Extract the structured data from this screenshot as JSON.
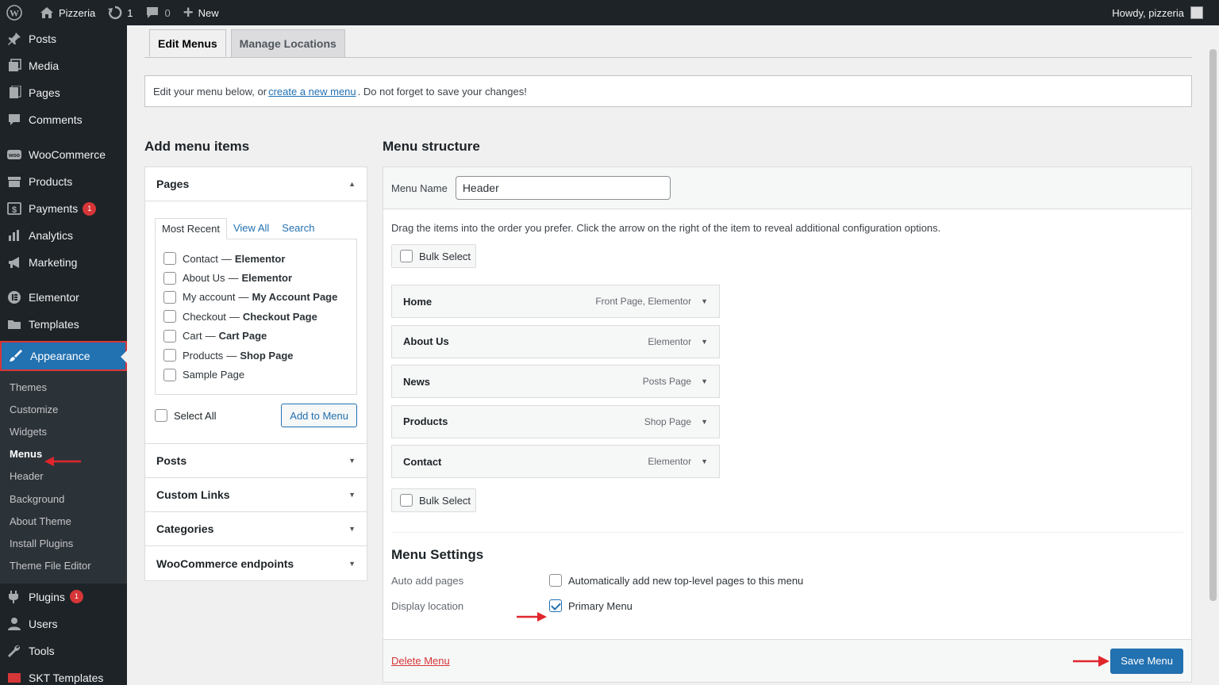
{
  "adminbar": {
    "site_name": "Pizzeria",
    "updates_count": "1",
    "comments_count": "0",
    "new_label": "New",
    "greeting": "Howdy, pizzeria"
  },
  "sidebar": {
    "items_top": [
      {
        "label": "Posts",
        "icon": "pin-icon"
      },
      {
        "label": "Media",
        "icon": "media-icon"
      },
      {
        "label": "Pages",
        "icon": "pages-icon"
      },
      {
        "label": "Comments",
        "icon": "comments-icon"
      }
    ],
    "items_shop": [
      {
        "label": "WooCommerce",
        "icon": "woo-icon"
      },
      {
        "label": "Products",
        "icon": "archive-icon"
      },
      {
        "label": "Payments",
        "icon": "money-icon",
        "badge": "1"
      },
      {
        "label": "Analytics",
        "icon": "bar-chart-icon"
      },
      {
        "label": "Marketing",
        "icon": "megaphone-icon"
      }
    ],
    "items_builder": [
      {
        "label": "Elementor",
        "icon": "elementor-icon"
      },
      {
        "label": "Templates",
        "icon": "folder-icon"
      }
    ],
    "appearance_label": "Appearance",
    "submenu": [
      "Themes",
      "Customize",
      "Widgets",
      "Menus",
      "Header",
      "Background",
      "About Theme",
      "Install Plugins",
      "Theme File Editor"
    ],
    "submenu_current": "Menus",
    "items_bottom": [
      {
        "label": "Plugins",
        "icon": "plugin-icon",
        "badge": "1"
      },
      {
        "label": "Users",
        "icon": "users-icon"
      },
      {
        "label": "Tools",
        "icon": "wrench-icon"
      },
      {
        "label": "SKT Templates",
        "icon": "skt-icon"
      }
    ]
  },
  "tabs": {
    "edit": "Edit Menus",
    "manage": "Manage Locations"
  },
  "notice": {
    "pre": "Edit your menu below, or ",
    "link": "create a new menu",
    "post": ". Do not forget to save your changes!"
  },
  "add_items": {
    "heading": "Add menu items",
    "pages_title": "Pages",
    "inner_tabs": [
      "Most Recent",
      "View All",
      "Search"
    ],
    "pages": [
      {
        "title": "Contact",
        "sub": "Elementor"
      },
      {
        "title": "About Us",
        "sub": "Elementor"
      },
      {
        "title": "My account",
        "sub": "My Account Page"
      },
      {
        "title": "Checkout",
        "sub": "Checkout Page"
      },
      {
        "title": "Cart",
        "sub": "Cart Page"
      },
      {
        "title": "Products",
        "sub": "Shop Page"
      },
      {
        "title": "Sample Page",
        "sub": ""
      }
    ],
    "dash": "—",
    "select_all": "Select All",
    "add_button": "Add to Menu",
    "sections": [
      "Posts",
      "Custom Links",
      "Categories",
      "WooCommerce endpoints"
    ]
  },
  "structure": {
    "heading": "Menu structure",
    "menu_name_label": "Menu Name",
    "menu_name_value": "Header",
    "instructions": "Drag the items into the order you prefer. Click the arrow on the right of the item to reveal additional configuration options.",
    "bulk_select": "Bulk Select",
    "items": [
      {
        "title": "Home",
        "type": "Front Page, Elementor"
      },
      {
        "title": "About Us",
        "type": "Elementor"
      },
      {
        "title": "News",
        "type": "Posts Page"
      },
      {
        "title": "Products",
        "type": "Shop Page"
      },
      {
        "title": "Contact",
        "type": "Elementor"
      }
    ],
    "settings_heading": "Menu Settings",
    "auto_add_label": "Auto add pages",
    "auto_add_text": "Automatically add new top-level pages to this menu",
    "auto_add_checked": false,
    "display_location_label": "Display location",
    "primary_menu_text": "Primary Menu",
    "primary_menu_checked": true,
    "delete_link": "Delete Menu",
    "save_button": "Save Menu"
  },
  "colors": {
    "accent": "#2271b1",
    "admin_dark": "#1d2327",
    "highlight_red": "#d63638"
  }
}
